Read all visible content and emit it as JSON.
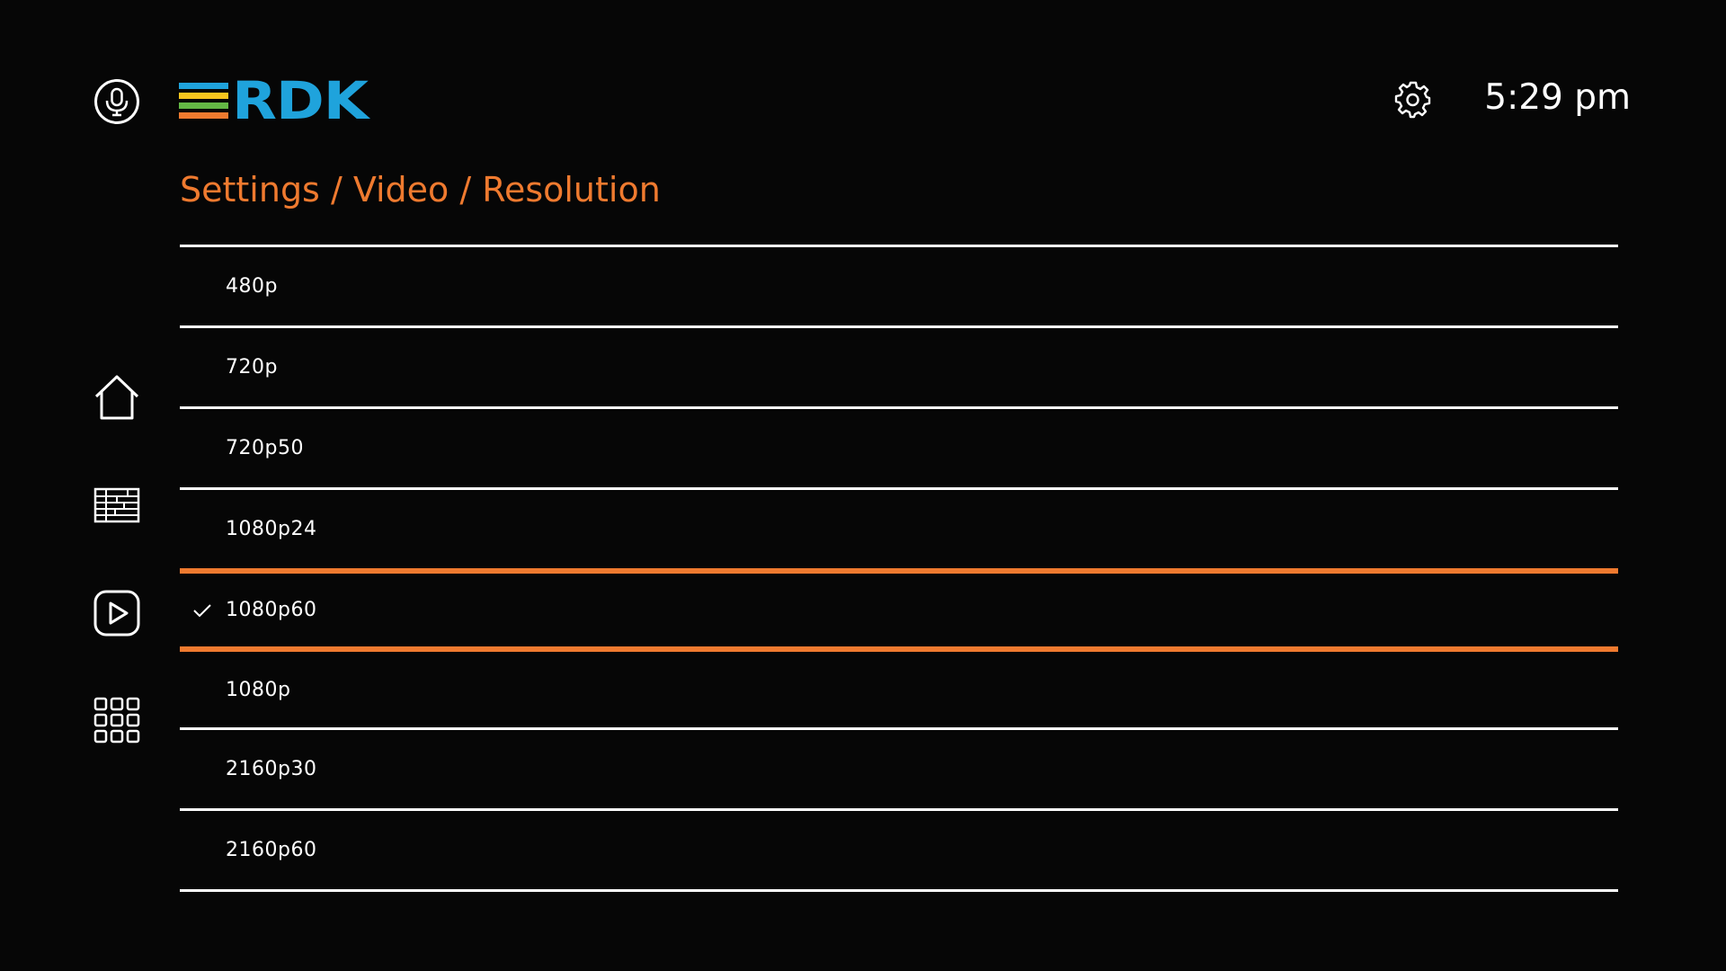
{
  "colors": {
    "background": "#060606",
    "text": "#ffffff",
    "accent": "#ef7a2f",
    "logo_text": "#1fa3dc",
    "logo_bars": [
      "#1fa3dc",
      "#f7c51e",
      "#64b845",
      "#ef7a2f"
    ]
  },
  "header": {
    "logo_text": "RDK",
    "clock": "5:29 pm",
    "icons": {
      "mic": "microphone-icon",
      "settings": "gear-icon"
    }
  },
  "sidebar": {
    "items": [
      {
        "icon": "home-icon"
      },
      {
        "icon": "guide-grid-icon"
      },
      {
        "icon": "play-icon"
      },
      {
        "icon": "apps-grid-icon"
      }
    ]
  },
  "breadcrumb": {
    "text": "Settings / Video / Resolution"
  },
  "resolutions": {
    "selected": "1080p60",
    "items": [
      {
        "label": "480p",
        "checked": false
      },
      {
        "label": "720p",
        "checked": false
      },
      {
        "label": "720p50",
        "checked": false
      },
      {
        "label": "1080p24",
        "checked": false
      },
      {
        "label": "1080p60",
        "checked": true
      },
      {
        "label": "1080p",
        "checked": false
      },
      {
        "label": "2160p30",
        "checked": false
      },
      {
        "label": "2160p60",
        "checked": false
      }
    ]
  }
}
